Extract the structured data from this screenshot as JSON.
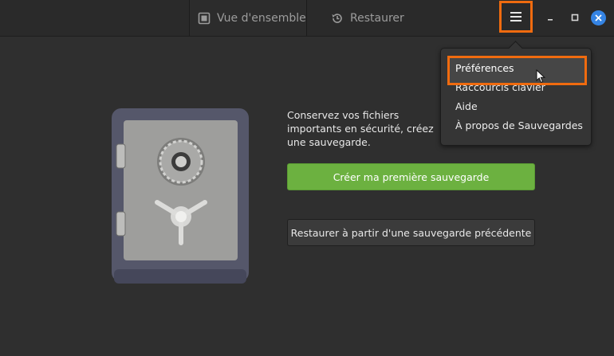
{
  "header": {
    "tabs": [
      {
        "label": "Vue d'ensemble",
        "icon": "overview-icon"
      },
      {
        "label": "Restaurer",
        "icon": "history-icon"
      }
    ],
    "menu_icon": "hamburger-menu-icon",
    "window_controls": [
      "minimize-icon",
      "maximize-icon",
      "close-icon"
    ]
  },
  "main": {
    "description": "Conservez vos fichiers importants en sécurité, créez une sauvegarde.",
    "primary_button": "Créer ma première sauvegarde",
    "secondary_button": "Restaurer à partir d'une sauvegarde précédente"
  },
  "menu": {
    "items": [
      "Préférences",
      "Raccourcis clavier",
      "Aide",
      "À propos de Sauvegardes"
    ]
  },
  "colors": {
    "accent": "#6cb140",
    "highlight": "#f06b0f",
    "close_button": "#3584e4"
  }
}
